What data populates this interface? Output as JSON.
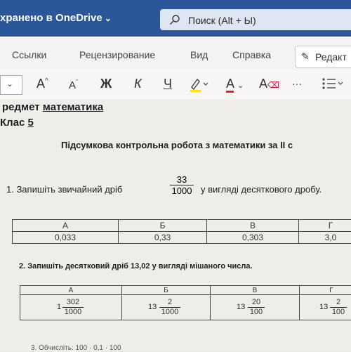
{
  "titlebar": {
    "saved_label": "хранено в OneDrive",
    "search_placeholder": "Поиск (Alt + Ы)",
    "bg_color": "#2b579a"
  },
  "menu": {
    "items": [
      "Ссылки",
      "Рецензирование",
      "Вид",
      "Справка"
    ],
    "edit_label": "Редакт"
  },
  "toolbar": {
    "grow_font": "A",
    "shrink_font": "A",
    "bold": "Ж",
    "italic": "К",
    "underline": "Ч",
    "font_color": "A",
    "more": "···"
  },
  "doc": {
    "subject_label": "редмет",
    "subject_value": "математика",
    "class_label": "Клас",
    "class_value": "5",
    "title": "Підсумкова контрольна робота з математики за ІІ с",
    "q1_text_a": "1. Запишіть звичайний дріб",
    "q1_frac": {
      "num": "33",
      "den": "1000"
    },
    "q1_text_b": "у вигляді десяткового дробу.",
    "q1_headers": [
      "А",
      "Б",
      "В",
      "Г"
    ],
    "q1_values": [
      "0,033",
      "0,33",
      "0,303",
      "3,0"
    ],
    "q2_text": "2. Запишіть десятковий дріб 13,02 у вигляді мішаного числа.",
    "q2_headers": [
      "А",
      "Б",
      "В",
      "Г"
    ],
    "q2_values": [
      {
        "whole": "1",
        "num": "302",
        "den": "1000"
      },
      {
        "whole": "13",
        "num": "2",
        "den": "1000"
      },
      {
        "whole": "13",
        "num": "20",
        "den": "100"
      },
      {
        "whole": "13",
        "num": "2",
        "den": "100"
      }
    ],
    "q3_text": "3. Обчисліть: 100 · 0,1 · 100"
  }
}
